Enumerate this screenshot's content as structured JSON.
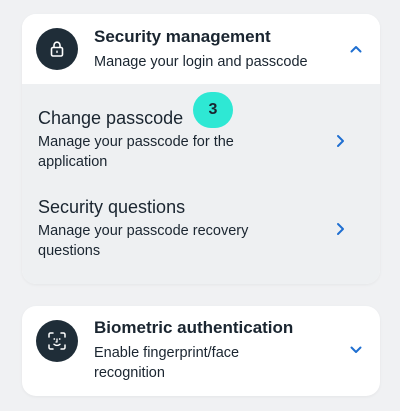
{
  "security": {
    "title": "Security management",
    "subtitle": "Manage your login and passcode",
    "icon": "lock-icon",
    "expanded": true,
    "items": [
      {
        "title": "Change passcode",
        "description": "Manage your passcode for the application"
      },
      {
        "title": "Security questions",
        "description": "Manage your passcode recovery questions"
      }
    ]
  },
  "badge": {
    "value": "3"
  },
  "biometric": {
    "title": "Biometric authentication",
    "subtitle": "Enable fingerprint/face recognition",
    "icon": "face-scan-icon",
    "expanded": false
  },
  "colors": {
    "accent": "#1f6fd1",
    "icon_bg": "#1f2d38",
    "badge": "#2ee8d4",
    "page_bg": "#f0f1f3",
    "expanded_bg": "#eef0f2"
  }
}
